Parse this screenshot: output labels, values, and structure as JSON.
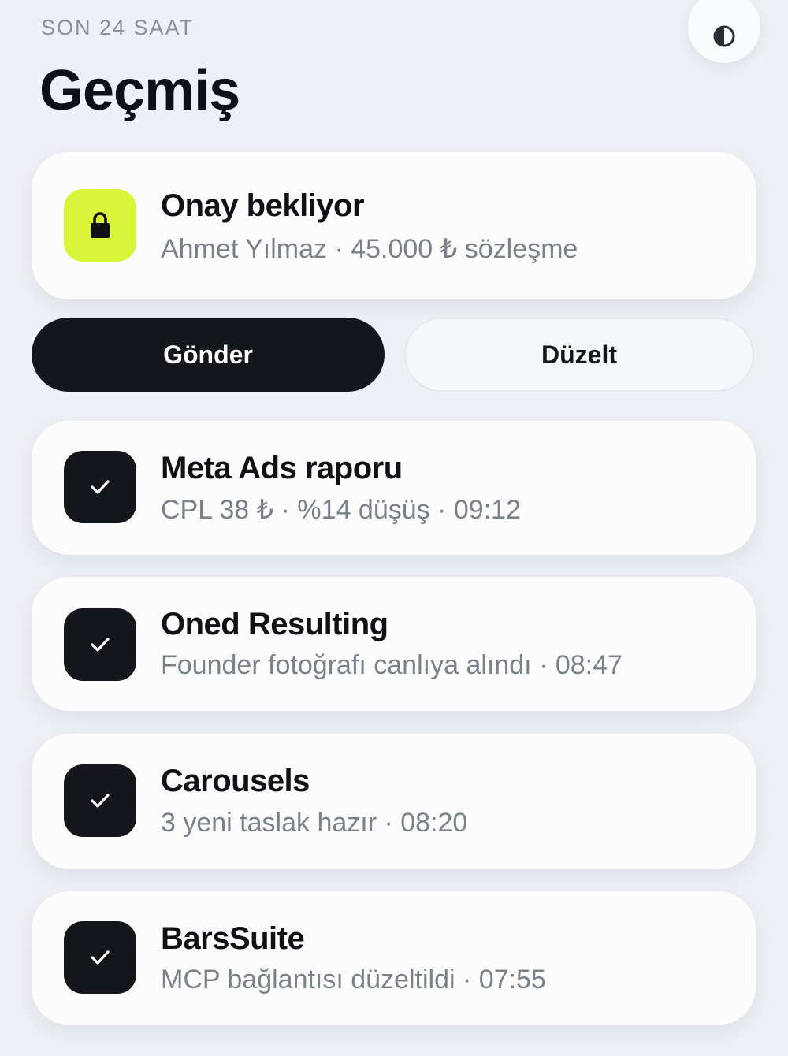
{
  "header": {
    "eyebrow": "SON 24 SAAT",
    "title": "Geçmiş",
    "theme_toggle_icon": "contrast-icon"
  },
  "pending": {
    "icon": "lock-icon",
    "accent": "#d8f53a",
    "title": "Onay bekliyor",
    "subtitle": "Ahmet Yılmaz · 45.000 ₺ sözleşme"
  },
  "actions": {
    "send_label": "Gönder",
    "edit_label": "Düzelt"
  },
  "history": [
    {
      "icon": "check-icon",
      "title": "Meta Ads raporu",
      "subtitle": "CPL 38 ₺ · %14 düşüş · 09:12"
    },
    {
      "icon": "check-icon",
      "title": "Oned Resulting",
      "subtitle": "Founder fotoğrafı canlıya alındı · 08:47"
    },
    {
      "icon": "check-icon",
      "title": "Carousels",
      "subtitle": "3 yeni taslak hazır · 08:20"
    },
    {
      "icon": "check-icon",
      "title": "BarsSuite",
      "subtitle": "MCP bağlantısı düzeltildi · 07:55"
    }
  ],
  "colors": {
    "background": "#eef0f5",
    "primary": "#14161c",
    "card": "#fcfcfd"
  }
}
